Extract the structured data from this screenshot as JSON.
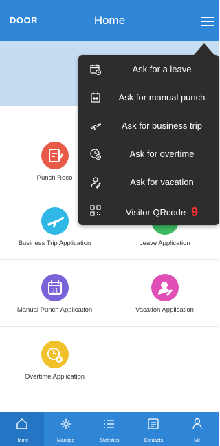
{
  "header": {
    "brand": "DOOR",
    "title": "Home"
  },
  "colors": {
    "header": "#2f86d6",
    "menu_bg": "#2d2d2d",
    "badge": "#ff2d2d"
  },
  "tiles": [
    {
      "label": "Punch Reco",
      "icon": "punch-record-icon",
      "color": "#e95b49"
    },
    {
      "label": "",
      "icon": "partially-hidden-icon",
      "color": "#4aa0e6"
    },
    {
      "label": "Business Trip Application",
      "icon": "airplane-icon",
      "color": "#2fb8e6"
    },
    {
      "label": "Leave Application",
      "icon": "leave-icon",
      "color": "#3cb961"
    },
    {
      "label": "Manual Punch Application",
      "icon": "calendar-icon",
      "color": "#7a63d9"
    },
    {
      "label": "Vacation Application",
      "icon": "vacation-icon",
      "color": "#e04fb5"
    },
    {
      "label": "Overtime Application",
      "icon": "overtime-clock-icon",
      "color": "#f1c12b"
    }
  ],
  "dropdown": {
    "items": [
      {
        "label": "Ask for a leave",
        "icon": "calendar-clock-icon"
      },
      {
        "label": "Ask for manual punch",
        "icon": "calendar-punch-icon"
      },
      {
        "label": "Ask for business trip",
        "icon": "plane-outline-icon"
      },
      {
        "label": "Ask for overtime",
        "icon": "clock-plus-icon"
      },
      {
        "label": "Ask for vacation",
        "icon": "person-vacation-icon"
      },
      {
        "label": "Visitor QRcode",
        "icon": "qrcode-icon",
        "badge": "9"
      }
    ]
  },
  "tabs": [
    {
      "label": "Home",
      "icon": "home-icon",
      "active": true
    },
    {
      "label": "Manage",
      "icon": "gear-icon"
    },
    {
      "label": "Statistics",
      "icon": "list-icon"
    },
    {
      "label": "Contacts",
      "icon": "contacts-card-icon"
    },
    {
      "label": "Me",
      "icon": "person-icon"
    }
  ]
}
